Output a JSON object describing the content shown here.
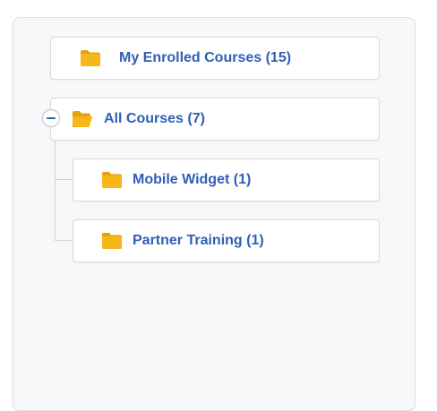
{
  "tree": {
    "enrolled": {
      "label": "My Enrolled Courses (15)",
      "icon": "folder-closed"
    },
    "all_courses": {
      "label": "All Courses (7)",
      "icon": "folder-open",
      "expanded": true
    },
    "children": [
      {
        "label": "Mobile Widget (1)",
        "icon": "folder-closed"
      },
      {
        "label": "Partner Training (1)",
        "icon": "folder-closed"
      }
    ]
  },
  "colors": {
    "label": "#2f5fb5",
    "folder": "#f6b71a",
    "folder_dark": "#e6a20b",
    "panel_bg": "#f7f8fa"
  }
}
